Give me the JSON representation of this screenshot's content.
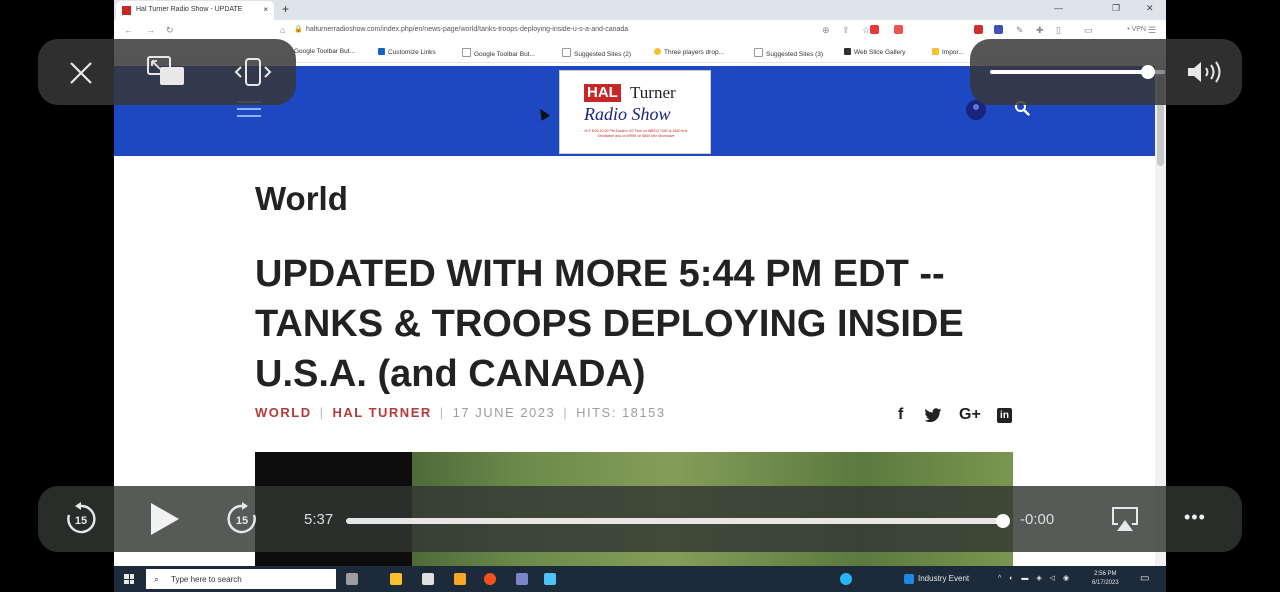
{
  "browser": {
    "tab_title": "Hal Turner Radio Show - UPDATE",
    "tab_close": "×",
    "new_tab": "+",
    "url": "halturnerradioshow.com/index.php/en/news-page/world/tanks-troops-deploying-inside-u-s-a-and-canada",
    "vpn_label": "• VPN",
    "menu_label": "☰",
    "bookmarks": [
      "Google Toolbar But...",
      "Customize Links",
      "Google Toolbar But...",
      "Suggested Sites (2)",
      "Three players drop...",
      "Suggested Sites (3)",
      "Web Slice Gallery",
      "Impor..."
    ]
  },
  "site": {
    "logo_hal": "HAL",
    "logo_turner": "Turner",
    "logo_radio": "Radio Show",
    "logo_sub": "M-F 8:00-10:00 PM Eastern US Time on WBCQ 7490 or 6160 kHz Shortwave and on WRMI on 5850 kHz Shortwave"
  },
  "article": {
    "category": "World",
    "headline": "UPDATED WITH MORE 5:44 PM EDT -- TANKS & TROOPS DEPLOYING INSIDE U.S.A. (and CANADA)",
    "meta_category": "WORLD",
    "meta_author": "HAL TURNER",
    "meta_date": "17 JUNE 2023",
    "meta_hits": "HITS: 18153",
    "sep": "|",
    "share": [
      "f",
      "🐦",
      "G+",
      "in"
    ]
  },
  "taskbar": {
    "search_placeholder": "Type here to search",
    "event_label": "Industry Event",
    "clock_time": "2:56 PM",
    "clock_date": "6/17/2023"
  },
  "player": {
    "elapsed": "5:37",
    "remaining": "-0:00",
    "progress": 0.996,
    "volume": 0.9,
    "skip_back_seconds": "15",
    "skip_forward_seconds": "15",
    "more_label": "•••"
  }
}
